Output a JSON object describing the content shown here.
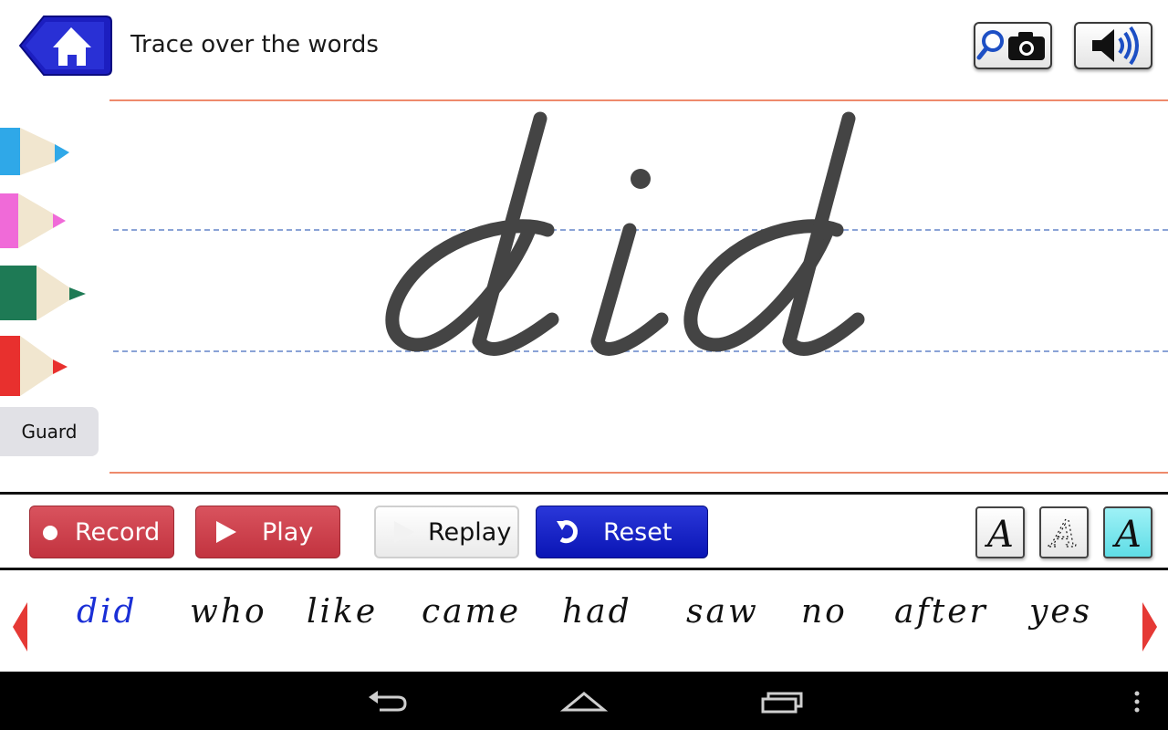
{
  "header": {
    "title": "Trace over the words",
    "home_icon": "home-icon",
    "zoom_camera_icon": "zoom-camera-icon",
    "sound_icon": "speaker-icon"
  },
  "canvas": {
    "current_word": "did",
    "ink_color": "#444444",
    "red_rule_color": "#ee8a6c",
    "blue_guide_color": "#8aa3d6"
  },
  "pencils": [
    {
      "name": "blue",
      "color": "#2fa8e8"
    },
    {
      "name": "pink",
      "color": "#f06ad8"
    },
    {
      "name": "green",
      "color": "#1e7a55"
    },
    {
      "name": "red",
      "color": "#e8302e"
    }
  ],
  "guard_label": "Guard",
  "toolbar": {
    "record_label": "Record",
    "play_label": "Play",
    "replay_label": "Replay",
    "reset_label": "Reset",
    "style_buttons": [
      "A",
      "A",
      "A"
    ]
  },
  "word_list": {
    "words": [
      "did",
      "who",
      "like",
      "came",
      "had",
      "saw",
      "no",
      "after",
      "yes"
    ],
    "active_index": 0,
    "active_color": "#1a2fd6",
    "arrow_color": "#e53935"
  },
  "navbar": {
    "back_icon": "back-icon",
    "home_icon": "home-outline-icon",
    "recent_icon": "recent-apps-icon",
    "menu_icon": "overflow-menu-icon"
  }
}
